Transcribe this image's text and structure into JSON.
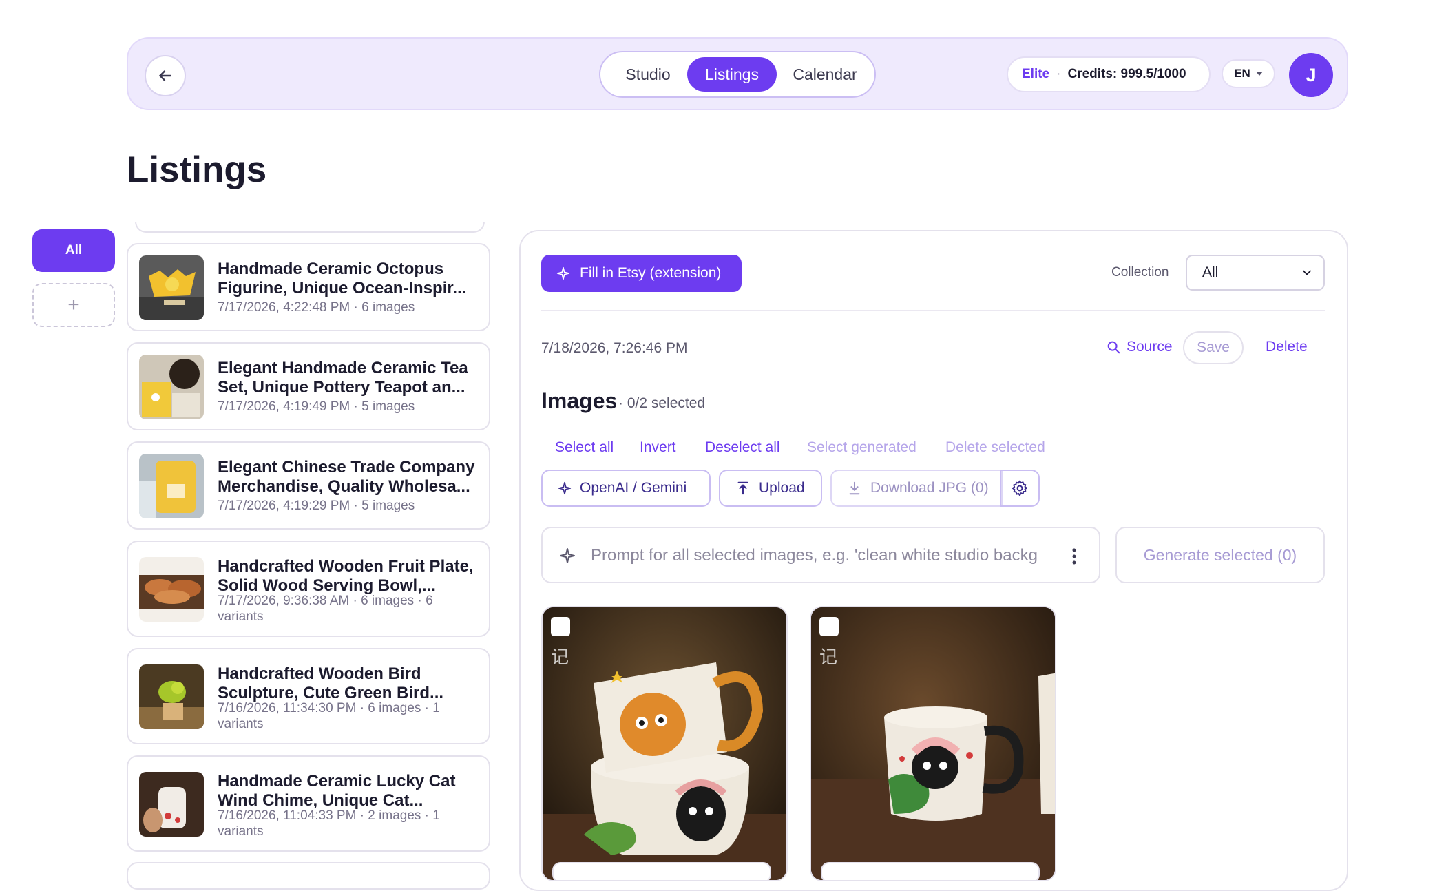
{
  "header": {
    "tabs": [
      {
        "label": "Studio",
        "active": false
      },
      {
        "label": "Listings",
        "active": true
      },
      {
        "label": "Calendar",
        "active": false
      }
    ],
    "plan": "Elite",
    "separator": "·",
    "credits": "Credits: 999.5/1000",
    "language": "EN",
    "avatar_initial": "J"
  },
  "page_title": "Listings",
  "filters": {
    "all_label": "All",
    "add_label": "+"
  },
  "listings": [
    {
      "title_1": "Handmade Ceramic Octopus",
      "title_2": "Figurine, Unique Ocean-Inspir...",
      "meta_1": "7/17/2026, 4:22:48 PM · 6 images",
      "meta_2": ""
    },
    {
      "title_1": "Elegant Handmade Ceramic Tea",
      "title_2": "Set, Unique Pottery Teapot an...",
      "meta_1": "7/17/2026, 4:19:49 PM · 5 images",
      "meta_2": ""
    },
    {
      "title_1": "Elegant Chinese Trade Company",
      "title_2": "Merchandise, Quality Wholesa...",
      "meta_1": "7/17/2026, 4:19:29 PM · 5 images",
      "meta_2": ""
    },
    {
      "title_1": "Handcrafted Wooden Fruit Plate,",
      "title_2": "Solid Wood Serving Bowl,...",
      "meta_1": "7/17/2026, 9:36:38 AM · 6 images · 6",
      "meta_2": "variants"
    },
    {
      "title_1": "Handcrafted Wooden Bird",
      "title_2": "Sculpture, Cute Green Bird...",
      "meta_1": "7/16/2026, 11:34:30 PM · 6 images · 1",
      "meta_2": "variants"
    },
    {
      "title_1": "Handmade Ceramic Lucky Cat",
      "title_2": "Wind Chime, Unique Cat...",
      "meta_1": "7/16/2026, 11:04:33 PM · 2 images · 1",
      "meta_2": "variants"
    }
  ],
  "panel": {
    "fill_button": "Fill in Etsy (extension)",
    "collection_label": "Collection",
    "collection_value": "All",
    "date": "7/18/2026, 7:26:46 PM",
    "source_label": "Source",
    "save_label": "Save",
    "delete_label": "Delete",
    "images_heading": "Images",
    "images_selected": "· 0/2 selected",
    "selection": {
      "select_all": "Select all",
      "invert": "Invert",
      "deselect_all": "Deselect all",
      "select_generated": "Select generated",
      "delete_selected": "Delete selected"
    },
    "tools": {
      "provider": "OpenAI / Gemini",
      "upload": "Upload",
      "download": "Download JPG (0)"
    },
    "prompt_placeholder": "Prompt for all selected images, e.g. 'clean white studio background'",
    "generate_label": "Generate selected (0)",
    "watermark": "记"
  },
  "colors": {
    "accent": "#6d3cf0",
    "header_bg": "#efeafd",
    "border": "#e4e1ec"
  }
}
